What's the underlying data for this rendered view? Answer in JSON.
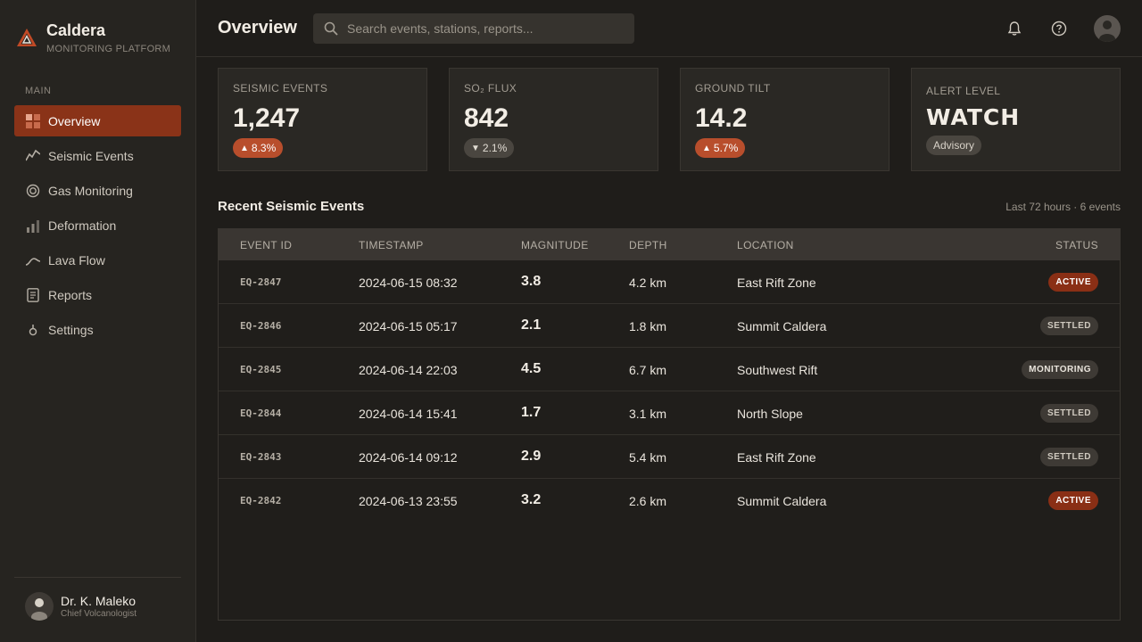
{
  "brand": {
    "name": "Caldera",
    "subtitle": "MONITORING PLATFORM"
  },
  "sidebar": {
    "section_label": "MAIN",
    "items": [
      {
        "label": "Overview",
        "icon": "grid-icon",
        "active": true
      },
      {
        "label": "Seismic Events",
        "icon": "waveform-icon",
        "active": false
      },
      {
        "label": "Gas Monitoring",
        "icon": "target-icon",
        "active": false
      },
      {
        "label": "Deformation",
        "icon": "bars-icon",
        "active": false
      },
      {
        "label": "Lava Flow",
        "icon": "flow-line-icon",
        "active": false
      },
      {
        "label": "Reports",
        "icon": "document-icon",
        "active": false
      },
      {
        "label": "Settings",
        "icon": "settings-icon",
        "active": false
      }
    ],
    "user": {
      "name": "Dr. K. Maleko",
      "role": "Chief Volcanologist"
    }
  },
  "header": {
    "title": "Overview",
    "search_placeholder": "Search events, stations, reports..."
  },
  "stats": [
    {
      "label": "SEISMIC EVENTS",
      "value": "1,247",
      "change": "8.3%",
      "direction": "up"
    },
    {
      "label": "SO₂ FLUX",
      "value": "842",
      "change": "2.1%",
      "direction": "down"
    },
    {
      "label": "GROUND TILT",
      "value": "14.2",
      "change": "5.7%",
      "direction": "up"
    },
    {
      "label": "ALERT LEVEL",
      "value": "WATCH",
      "tag": "Advisory"
    }
  ],
  "events": {
    "title": "Recent Seismic Events",
    "meta": "Last 72 hours · 6 events",
    "columns": [
      "EVENT ID",
      "TIMESTAMP",
      "MAGNITUDE",
      "DEPTH",
      "LOCATION",
      "STATUS"
    ],
    "rows": [
      {
        "id": "EQ-2847",
        "timestamp": "2024-06-15 08:32",
        "magnitude": "3.8",
        "depth": "4.2 km",
        "location": "East Rift Zone",
        "status": "ACTIVE"
      },
      {
        "id": "EQ-2846",
        "timestamp": "2024-06-15 05:17",
        "magnitude": "2.1",
        "depth": "1.8 km",
        "location": "Summit Caldera",
        "status": "SETTLED"
      },
      {
        "id": "EQ-2845",
        "timestamp": "2024-06-14 22:03",
        "magnitude": "4.5",
        "depth": "6.7 km",
        "location": "Southwest Rift",
        "status": "MONITORING"
      },
      {
        "id": "EQ-2844",
        "timestamp": "2024-06-14 15:41",
        "magnitude": "1.7",
        "depth": "3.1 km",
        "location": "North Slope",
        "status": "SETTLED"
      },
      {
        "id": "EQ-2843",
        "timestamp": "2024-06-14 09:12",
        "magnitude": "2.9",
        "depth": "5.4 km",
        "location": "East Rift Zone",
        "status": "SETTLED"
      },
      {
        "id": "EQ-2842",
        "timestamp": "2024-06-13 23:55",
        "magnitude": "3.2",
        "depth": "2.6 km",
        "location": "Summit Caldera",
        "status": "ACTIVE"
      }
    ]
  },
  "colors": {
    "accent": "#8a3318",
    "badge_up": "#b84e2c",
    "status_active": "#8a2f15"
  }
}
